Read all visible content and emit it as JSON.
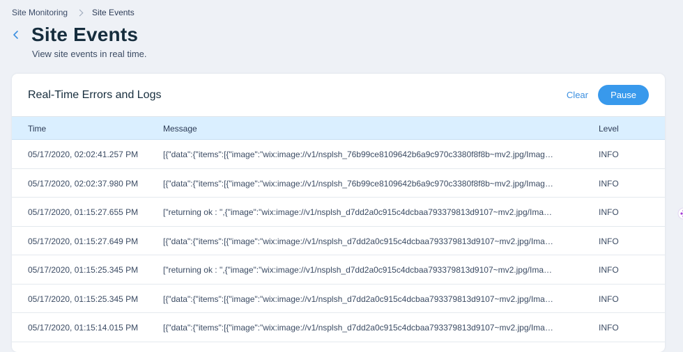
{
  "breadcrumb": {
    "parent": "Site Monitoring",
    "current": "Site Events"
  },
  "header": {
    "back_icon": "chevron-left-icon",
    "title": "Site Events",
    "subtitle": "View site events in real time."
  },
  "panel": {
    "title": "Real-Time Errors and Logs",
    "clear_label": "Clear",
    "pause_label": "Pause"
  },
  "table": {
    "columns": {
      "time": "Time",
      "message": "Message",
      "level": "Level"
    },
    "rows": [
      {
        "time": "05/17/2020, 02:02:41.257 PM",
        "message": "[{\"data\":{\"items\":[{\"image\":\"wix:image://v1/nsplsh_76b99ce8109642b6a9c970c3380f8f8b~mv2.jpg/Image%20...",
        "level": "INFO"
      },
      {
        "time": "05/17/2020, 02:02:37.980 PM",
        "message": "[{\"data\":{\"items\":[{\"image\":\"wix:image://v1/nsplsh_76b99ce8109642b6a9c970c3380f8f8b~mv2.jpg/Image%20...",
        "level": "INFO"
      },
      {
        "time": "05/17/2020, 01:15:27.655 PM",
        "message": "[\"returning ok : \",{\"image\":\"wix:image://v1/nsplsh_d7dd2a0c915c4dcbaa793379813d9107~mv2.jpg/Image%20...",
        "level": "INFO"
      },
      {
        "time": "05/17/2020, 01:15:27.649 PM",
        "message": "[{\"data\":{\"items\":[{\"image\":\"wix:image://v1/nsplsh_d7dd2a0c915c4dcbaa793379813d9107~mv2.jpg/Image%20...",
        "level": "INFO"
      },
      {
        "time": "05/17/2020, 01:15:25.345 PM",
        "message": "[\"returning ok : \",{\"image\":\"wix:image://v1/nsplsh_d7dd2a0c915c4dcbaa793379813d9107~mv2.jpg/Image%20...",
        "level": "INFO"
      },
      {
        "time": "05/17/2020, 01:15:25.345 PM",
        "message": "[{\"data\":{\"items\":[{\"image\":\"wix:image://v1/nsplsh_d7dd2a0c915c4dcbaa793379813d9107~mv2.jpg/Image%20...",
        "level": "INFO"
      },
      {
        "time": "05/17/2020, 01:15:14.015 PM",
        "message": "[{\"data\":{\"items\":[{\"image\":\"wix:image://v1/nsplsh_d7dd2a0c915c4dcbaa793379813d9107~mv2.jpg/Image%20...",
        "level": "INFO"
      }
    ]
  },
  "colors": {
    "background": "#eef1f6",
    "accent": "#3899ec",
    "header_row": "#daefff",
    "title_text": "#162d3d"
  }
}
